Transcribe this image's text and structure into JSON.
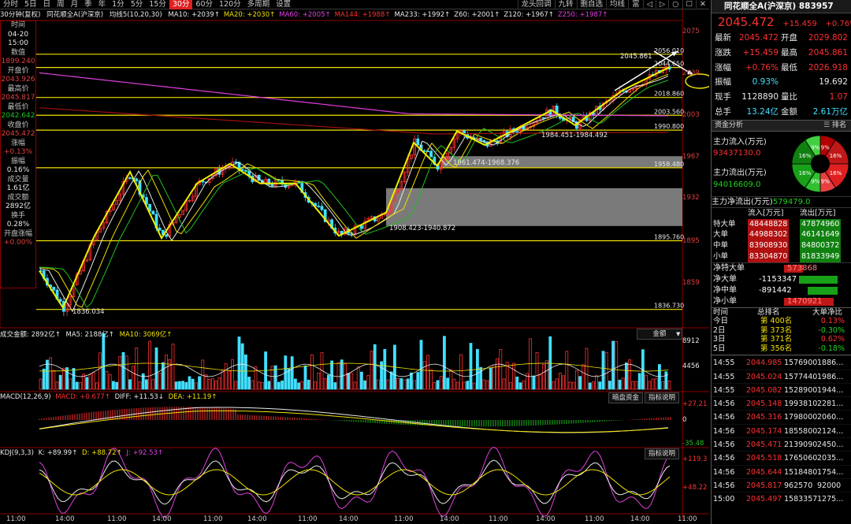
{
  "toolbar": {
    "items": [
      "分时",
      "5日",
      "日",
      "周",
      "月",
      "季",
      "年",
      "1分",
      "5分",
      "15分",
      "30分",
      "60分",
      "120分",
      "多周期",
      "设置"
    ],
    "active_index": 10,
    "right_items": [
      "龙头回调",
      "九转",
      "删自选",
      "均线",
      "富"
    ],
    "window_buttons": [
      "◁",
      "▷",
      "○",
      "☐",
      "✕"
    ]
  },
  "ma_bar": {
    "period": "30分钟(复权)",
    "name": "同花顺全A(沪深京)",
    "ma_def": "均线5(10,20,30)",
    "items": [
      {
        "text": "MA10: +2039↑",
        "color": "#e8e8e8"
      },
      {
        "text": "MA20: +2030↑",
        "color": "#f0e000"
      },
      {
        "text": "MA60: +2005↑",
        "color": "#e040e0"
      },
      {
        "text": "MA144: +1988↑",
        "color": "#ff3030"
      },
      {
        "text": "MA233: +1992↑",
        "color": "#e8e8e8"
      },
      {
        "text": "Z60: +2001↑",
        "color": "#e8e8e8"
      },
      {
        "text": "Z120: +1967↑",
        "color": "#e8e8e8"
      },
      {
        "text": "Z250: +1987↑",
        "color": "#e040e0"
      }
    ]
  },
  "left_panel": {
    "rows": [
      {
        "t": "时间",
        "c": "l"
      },
      {
        "t": "04-20",
        "c": "w"
      },
      {
        "t": "15:00",
        "c": "w"
      },
      {
        "t": "数值",
        "c": "l"
      },
      {
        "t": "1899.240",
        "c": "v"
      },
      {
        "t": "开盘价",
        "c": "l"
      },
      {
        "t": "2043.926",
        "c": "v"
      },
      {
        "t": "最高价",
        "c": "l"
      },
      {
        "t": "2045.817",
        "c": "v"
      },
      {
        "t": "最低价",
        "c": "l"
      },
      {
        "t": "2042.642",
        "c": "g"
      },
      {
        "t": "收盘价",
        "c": "l"
      },
      {
        "t": "2045.472",
        "c": "v"
      },
      {
        "t": "涨幅",
        "c": "l"
      },
      {
        "t": "+0.13%",
        "c": "v"
      },
      {
        "t": "振幅",
        "c": "l"
      },
      {
        "t": "0.16%",
        "c": "w"
      },
      {
        "t": "成交量",
        "c": "l"
      },
      {
        "t": "1.61亿",
        "c": "w"
      },
      {
        "t": "成交额",
        "c": "l"
      },
      {
        "t": "2892亿",
        "c": "w"
      },
      {
        "t": "换手",
        "c": "l"
      },
      {
        "t": "0.28%",
        "c": "w"
      },
      {
        "t": "开盘涨幅",
        "c": "l"
      },
      {
        "t": "+0.00%",
        "c": "v"
      }
    ]
  },
  "price_scale": [
    "2075",
    "2039",
    "2003",
    "1967",
    "1932",
    "1895",
    "1859"
  ],
  "levels": [
    {
      "v": 2056.01,
      "label": "2056.010"
    },
    {
      "v": 2044.65,
      "label": "2044.650"
    },
    {
      "v": 2018.86,
      "label": "2018.860"
    },
    {
      "v": 2003.56,
      "label": "2003.560"
    },
    {
      "v": 1990.8,
      "label": "1990.800"
    },
    {
      "v": 1958.48,
      "label": "1958.480"
    },
    {
      "v": 1895.76,
      "label": "1895.760"
    },
    {
      "v": 1836.73,
      "label": "1836.730"
    }
  ],
  "annotations": {
    "high_label": "2045.861",
    "low_label": "1836.034",
    "zone1": "1908.423-1940.872",
    "zone2": "1961.474-1968.376",
    "zone3": "1984.451-1984.492"
  },
  "volume": {
    "title": "成交金额: 2892亿↑",
    "ma5": "MA5: 2188亿↑",
    "ma10": "MA10: 3069亿↑",
    "button": "金额",
    "scale": [
      "8912",
      "4456"
    ]
  },
  "macd": {
    "title": "MACD(12,26,9)",
    "macd": "MACD: +0.677↑",
    "diff": "DIFF: +11.53↓",
    "dea": "DEA: +11.19↑",
    "buttons": [
      "暗盘资金",
      "指标说明"
    ],
    "scale": [
      "+27.21",
      "0",
      "-35.48"
    ]
  },
  "kdj": {
    "title": "KDJ(9,3,3)",
    "k": "K: +89.99↑",
    "d": "D: +88.72↑",
    "j": "J: +92.53↑",
    "button": "指标说明",
    "scale": [
      "+119.3",
      "+48.22"
    ]
  },
  "xaxis": [
    "11:00",
    "14:00",
    "11:00",
    "14:00",
    "11:00",
    "14:00",
    "11:00",
    "14:00",
    "11:00",
    "14:00",
    "11:00",
    "14:00",
    "11:00",
    "14:00",
    "11:00"
  ],
  "quote": {
    "name": "同花顺全A(沪深京) 883957",
    "price": "2045.472",
    "change": "+15.459",
    "pct": "+0.76%",
    "rows": [
      {
        "l1": "最新",
        "v1": "2045.472",
        "c1": "red",
        "l2": "开盘",
        "v2": "2029.802",
        "c2": "red"
      },
      {
        "l1": "涨跌",
        "v1": "+15.459",
        "c1": "red",
        "l2": "最高",
        "v2": "2045.861",
        "c2": "red"
      },
      {
        "l1": "涨幅",
        "v1": "+0.76%",
        "c1": "red",
        "l2": "最低",
        "v2": "2026.918",
        "c2": "red"
      },
      {
        "l1": "振幅",
        "v1": "0.93%",
        "c1": "cyan",
        "l2": "",
        "v2": "19.692",
        "c2": "white"
      },
      {
        "l1": "现手",
        "v1": "1128890",
        "c1": "white",
        "l2": "量比",
        "v2": "1.07",
        "c2": "red"
      },
      {
        "l1": "总手",
        "v1": "13.24亿",
        "c1": "cyan",
        "l2": "金额",
        "v2": "2.61万亿",
        "c2": "cyan"
      }
    ]
  },
  "fund": {
    "header": "资金分析",
    "rank_tab": "排名",
    "inflow_label": "主力流入(万元)",
    "inflow_value": "93437130.0",
    "outflow_label": "主力流出(万元)",
    "outflow_value": "94016609.0",
    "net_label": "主力净流出(万元)",
    "net_value": "579479.0",
    "pie": [
      {
        "label": "9%",
        "value": 9,
        "color": "#b00000"
      },
      {
        "label": "16%",
        "value": 16,
        "color": "#c01818"
      },
      {
        "label": "16%",
        "value": 16,
        "color": "#e02020"
      },
      {
        "label": "9%",
        "value": 9,
        "color": "#e84040"
      },
      {
        "label": "9%",
        "value": 9,
        "color": "#30c030"
      },
      {
        "label": "16%",
        "value": 16,
        "color": "#18a018"
      },
      {
        "label": "16%",
        "value": 16,
        "color": "#108010"
      },
      {
        "label": "9%",
        "value": 9,
        "color": "#40d040"
      }
    ],
    "table_header": [
      "流入[万元]",
      "流出[万元]"
    ],
    "table": [
      {
        "name": "特大单",
        "in": "48448828",
        "out": "47874960"
      },
      {
        "name": "大单",
        "in": "44988302",
        "out": "46141649"
      },
      {
        "name": "中单",
        "in": "83908930",
        "out": "84800372"
      },
      {
        "name": "小单",
        "in": "83304870",
        "out": "81833949"
      }
    ],
    "net": [
      {
        "name": "净特大单",
        "value": "573868",
        "sign": 1,
        "ratio": 0.35
      },
      {
        "name": "净大单",
        "value": "-1153347",
        "sign": -1,
        "ratio": 0.72
      },
      {
        "name": "净中单",
        "value": "-891442",
        "sign": -1,
        "ratio": 0.56
      },
      {
        "name": "净小单",
        "value": "1470921",
        "sign": 1,
        "ratio": 0.92
      }
    ]
  },
  "rank": {
    "headers": [
      "时间",
      "总排名",
      "大单净比"
    ],
    "rows": [
      {
        "d": "今日",
        "r": "第 400名",
        "p": "0.13%"
      },
      {
        "d": "2日",
        "r": "第 373名",
        "p": "-0.30%"
      },
      {
        "d": "3日",
        "r": "第 371名",
        "p": "0.62%"
      },
      {
        "d": "5日",
        "r": "第 356名",
        "p": "-0.18%"
      }
    ]
  },
  "ticks": [
    {
      "t": "14:55",
      "p": "2044.985",
      "v": "1576900",
      "x": "1886..."
    },
    {
      "t": "14:55",
      "p": "2045.024",
      "v": "1577440",
      "x": "1986..."
    },
    {
      "t": "14:55",
      "p": "2045.082",
      "v": "1528900",
      "x": "1944..."
    },
    {
      "t": "14:56",
      "p": "2045.148",
      "v": "1993810",
      "x": "2281..."
    },
    {
      "t": "14:56",
      "p": "2045.316",
      "v": "1798000",
      "x": "2060..."
    },
    {
      "t": "14:56",
      "p": "2045.174",
      "v": "1855800",
      "x": "2124..."
    },
    {
      "t": "14:56",
      "p": "2045.471",
      "v": "2139090",
      "x": "2450..."
    },
    {
      "t": "14:56",
      "p": "2045.518",
      "v": "1765060",
      "x": "2035..."
    },
    {
      "t": "14:56",
      "p": "2045.644",
      "v": "1518480",
      "x": "1754..."
    },
    {
      "t": "14:56",
      "p": "2045.817",
      "v": "962570",
      "x": "92000"
    },
    {
      "t": "15:00",
      "p": "2045.497",
      "v": "1583357",
      "x": "1275..."
    }
  ]
}
